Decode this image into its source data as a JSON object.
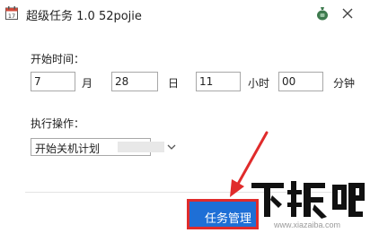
{
  "window": {
    "title": "超级任务 1.0 52pojie",
    "app_icon_label": "17",
    "icons": [
      "calendar-icon",
      "bag-icon",
      "close-icon"
    ]
  },
  "start_time": {
    "label": "开始时间：",
    "month_value": "7",
    "month_unit": "月",
    "day_value": "28",
    "day_unit": "日",
    "hour_value": "11",
    "hour_unit": "小时",
    "minute_value": "00",
    "minute_unit": "分钟"
  },
  "operation": {
    "label": "执行操作：",
    "selected": "开始关机计划"
  },
  "footer": {
    "manager_button_label": "任务管理"
  },
  "watermark": {
    "logo_text": "下载吧",
    "domain": "www.xiazaiba.com"
  },
  "colors": {
    "button_blue": "#1e6fd6",
    "highlight_red": "#e02b2b",
    "icon_green": "#3e7a4e"
  }
}
